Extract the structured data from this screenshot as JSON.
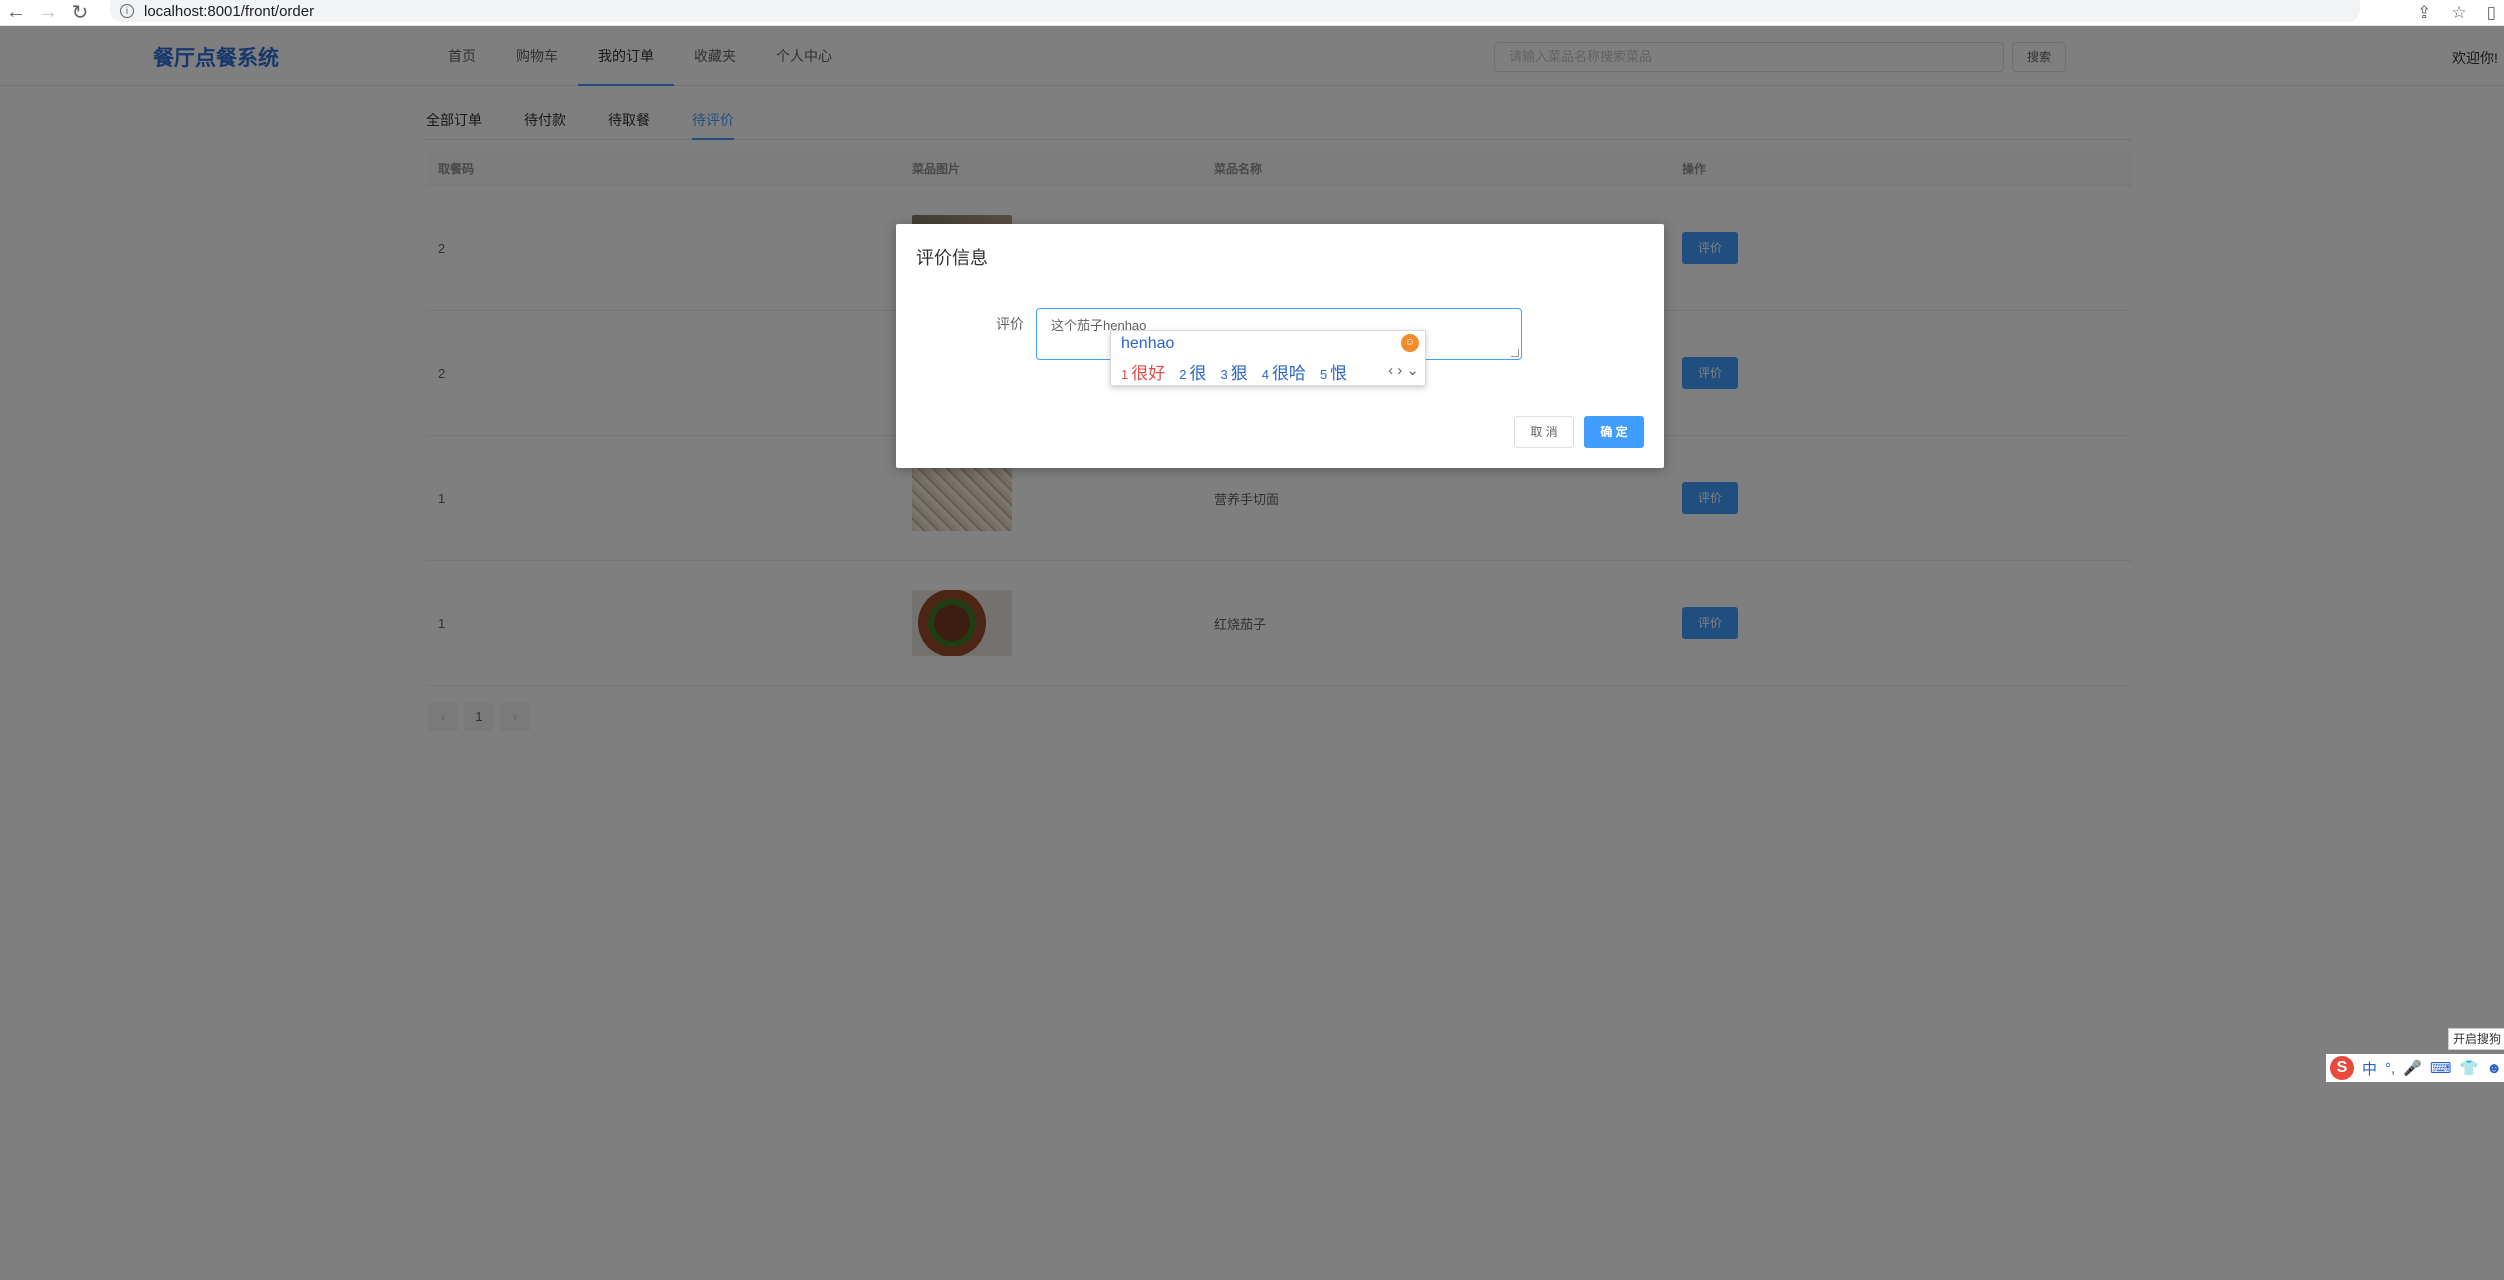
{
  "browser": {
    "url": "localhost:8001/front/order"
  },
  "header": {
    "brand": "餐厅点餐系统",
    "nav": [
      "首页",
      "购物车",
      "我的订单",
      "收藏夹",
      "个人中心"
    ],
    "active_nav": "我的订单",
    "search_placeholder": "请输入菜品名称搜索菜品",
    "search_button": "搜索",
    "welcome": "欢迎你!"
  },
  "tabs": [
    "全部订单",
    "待付款",
    "待取餐",
    "待评价"
  ],
  "active_tab": "待评价",
  "table": {
    "columns": [
      "取餐码",
      "菜品图片",
      "菜品名称",
      "操作"
    ],
    "rows": [
      {
        "code": "2",
        "name": "",
        "action": "评价"
      },
      {
        "code": "2",
        "name": "",
        "action": "评价"
      },
      {
        "code": "1",
        "name": "营养手切面",
        "action": "评价"
      },
      {
        "code": "1",
        "name": "红烧茄子",
        "action": "评价"
      }
    ]
  },
  "pager": {
    "prev": "‹",
    "page": "1",
    "next": "›"
  },
  "dialog": {
    "title": "评价信息",
    "label": "评价",
    "textarea_value": "这个茄子henhao",
    "cancel": "取 消",
    "ok": "确 定"
  },
  "ime": {
    "composition": "henhao",
    "candidates": [
      {
        "num": "1",
        "text": "很好"
      },
      {
        "num": "2",
        "text": "很"
      },
      {
        "num": "3",
        "text": "狠"
      },
      {
        "num": "4",
        "text": "很哈"
      },
      {
        "num": "5",
        "text": "恨"
      }
    ],
    "arrows": "‹ › ⌄"
  },
  "ime_bar": {
    "logo": "S",
    "lang": "中",
    "tooltip": "开启搜狗"
  }
}
